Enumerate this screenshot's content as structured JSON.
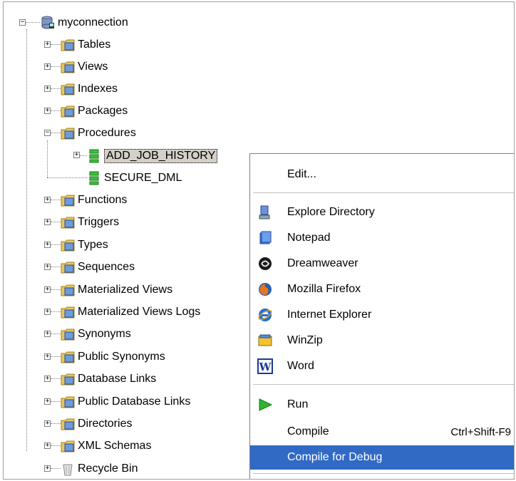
{
  "tree": {
    "root": {
      "label": "myconnection"
    },
    "items": [
      {
        "label": "Tables",
        "icon": "folder-tables-icon",
        "expanded": false
      },
      {
        "label": "Views",
        "icon": "folder-views-icon",
        "expanded": false
      },
      {
        "label": "Indexes",
        "icon": "folder-indexes-icon",
        "expanded": false
      },
      {
        "label": "Packages",
        "icon": "folder-packages-icon",
        "expanded": false
      },
      {
        "label": "Procedures",
        "icon": "folder-procedures-icon",
        "expanded": true
      },
      {
        "label": "Functions",
        "icon": "folder-functions-icon",
        "expanded": false
      },
      {
        "label": "Triggers",
        "icon": "folder-triggers-icon",
        "expanded": false
      },
      {
        "label": "Types",
        "icon": "folder-types-icon",
        "expanded": false
      },
      {
        "label": "Sequences",
        "icon": "folder-sequences-icon",
        "expanded": false
      },
      {
        "label": "Materialized Views",
        "icon": "folder-materialized-views-icon",
        "expanded": false
      },
      {
        "label": "Materialized Views Logs",
        "icon": "folder-materialized-views-logs-icon",
        "expanded": false
      },
      {
        "label": "Synonyms",
        "icon": "folder-synonyms-icon",
        "expanded": false
      },
      {
        "label": "Public Synonyms",
        "icon": "folder-public-synonyms-icon",
        "expanded": false
      },
      {
        "label": "Database Links",
        "icon": "folder-database-links-icon",
        "expanded": false
      },
      {
        "label": "Public Database Links",
        "icon": "folder-public-database-links-icon",
        "expanded": false
      },
      {
        "label": "Directories",
        "icon": "folder-directories-icon",
        "expanded": false
      },
      {
        "label": "XML Schemas",
        "icon": "folder-xml-schemas-icon",
        "expanded": false
      },
      {
        "label": "Recycle Bin",
        "icon": "recycle-bin-icon",
        "expanded": false
      }
    ],
    "procedures": [
      {
        "label": "ADD_JOB_HISTORY",
        "selected": true
      },
      {
        "label": "SECURE_DML",
        "selected": false
      }
    ]
  },
  "context_menu": {
    "items": [
      {
        "label": "Edit...",
        "icon": ""
      },
      {
        "label": "Explore Directory",
        "icon": "explore-directory-icon"
      },
      {
        "label": "Notepad",
        "icon": "notepad-icon"
      },
      {
        "label": "Dreamweaver",
        "icon": "dreamweaver-icon"
      },
      {
        "label": "Mozilla Firefox",
        "icon": "firefox-icon"
      },
      {
        "label": "Internet Explorer",
        "icon": "internet-explorer-icon"
      },
      {
        "label": "WinZip",
        "icon": "winzip-icon"
      },
      {
        "label": "Word",
        "icon": "word-icon"
      },
      {
        "label": "Run",
        "icon": "run-icon"
      },
      {
        "label": "Compile",
        "icon": "",
        "shortcut": "Ctrl+Shift-F9"
      },
      {
        "label": "Compile for Debug",
        "icon": "",
        "highlighted": true
      }
    ]
  },
  "colors": {
    "highlight": "#316ac5",
    "folder": "#e8c85a",
    "tree_line": "#808080"
  }
}
